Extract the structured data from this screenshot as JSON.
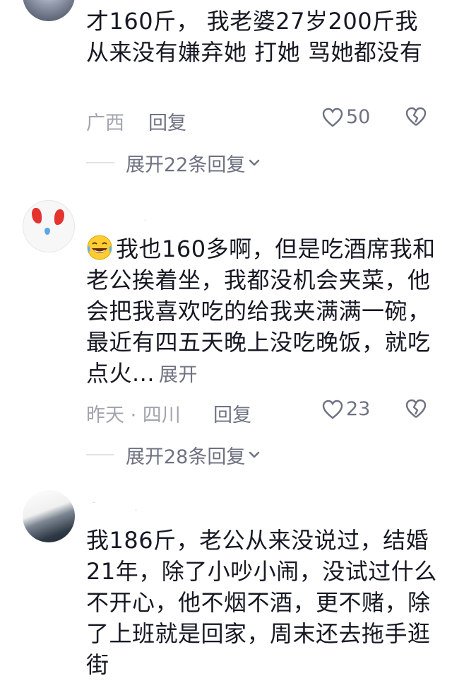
{
  "comments": [
    {
      "text": "才160斤， 我老婆27岁200斤我从来没有嫌弃她 打她 骂她都没有",
      "location": "广西",
      "reply_label": "回复",
      "likes": "50",
      "expand_replies": "展开22条回复"
    },
    {
      "text": "我也160多啊，但是吃酒席我和老公挨着坐，我都没机会夹菜，他会把我喜欢吃的给我夹满满一碗，最近有四五天晚上没吃晚饭，就吃点火...",
      "expand_label": "展开",
      "time_location": "昨天 · 四川",
      "reply_label": "回复",
      "likes": "23",
      "expand_replies": "展开28条回复"
    },
    {
      "text": "我186斤，老公从来没说过，结婚21年，除了小吵小闹，没试过什么不开心，他不烟不酒，更不赌，除了上班就是回家，周末还去拖手逛街"
    }
  ],
  "colors": {
    "text": "#161823",
    "secondary": "#6e7282",
    "muted": "#a2a5ae"
  },
  "icons": [
    "heart-outline-icon",
    "broken-heart-icon",
    "chevron-down-icon",
    "laughing-tears-emoji-icon"
  ]
}
